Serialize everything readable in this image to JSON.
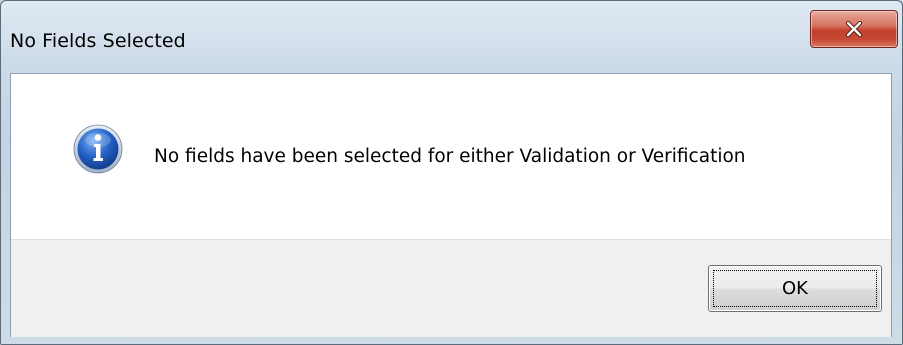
{
  "dialog": {
    "title": "No Fields Selected",
    "message": "No fields have been selected for either Validation or Verification",
    "icon": "info-icon",
    "buttons": {
      "ok_label": "OK",
      "close_icon": "close-icon"
    }
  },
  "colors": {
    "close_button": "#c84a35",
    "info_icon": "#1f58b8",
    "footer": "#f0f0f0"
  }
}
